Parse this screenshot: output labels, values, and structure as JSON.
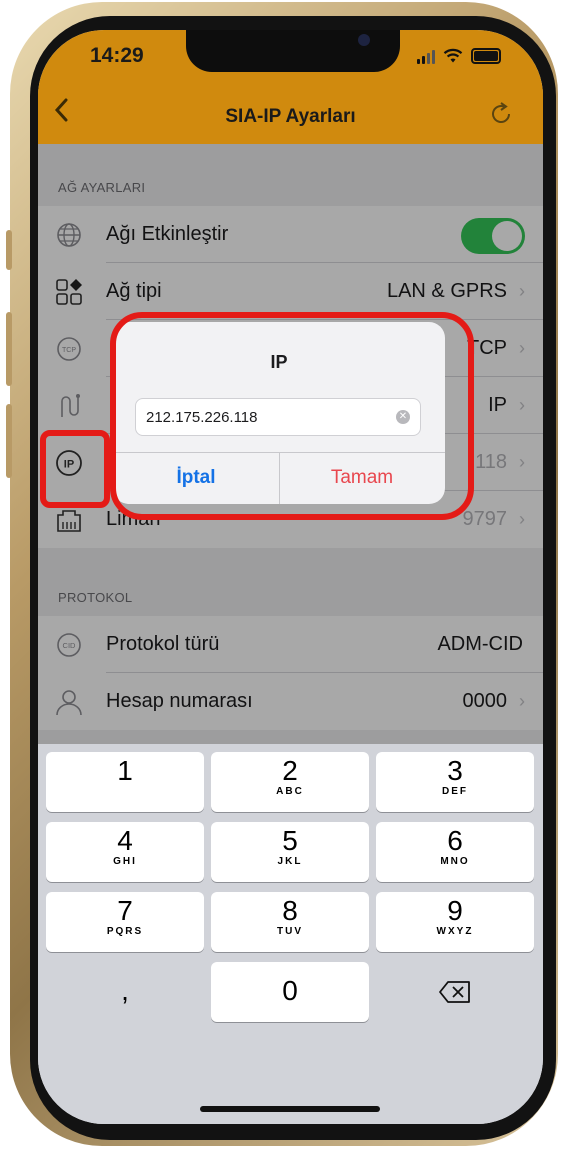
{
  "status_bar": {
    "time": "14:29"
  },
  "nav": {
    "back_icon": "chevron-left-icon",
    "title": "SIA-IP Ayarları",
    "refresh_icon": "refresh-icon"
  },
  "sections": {
    "network": {
      "header": "AĞ AYARLARI",
      "rows": [
        {
          "icon": "globe-icon",
          "label": "Ağı Etkinleştir",
          "toggle_on": true
        },
        {
          "icon": "network-type-icon",
          "label": "Ağ tipi",
          "value": "LAN & GPRS"
        },
        {
          "icon": "tcp-icon",
          "label": "",
          "value": "TCP"
        },
        {
          "icon": "route-icon",
          "label": "",
          "value": "IP"
        },
        {
          "icon": "ip-icon",
          "label": "",
          "value": "118"
        },
        {
          "icon": "port-icon",
          "label": "Liman",
          "value": "9797"
        }
      ]
    },
    "protocol": {
      "header": "PROTOKOL",
      "rows": [
        {
          "icon": "cid-icon",
          "label": "Protokol türü",
          "value": "ADM-CID"
        },
        {
          "icon": "user-icon",
          "label": "Hesap numarası",
          "value": "0000"
        }
      ]
    }
  },
  "dialog": {
    "title": "IP",
    "input_value": "212.175.226.118",
    "cancel_label": "İptal",
    "ok_label": "Tamam"
  },
  "keyboard": {
    "keys": [
      {
        "num": "1",
        "letters": ""
      },
      {
        "num": "2",
        "letters": "ABC"
      },
      {
        "num": "3",
        "letters": "DEF"
      },
      {
        "num": "4",
        "letters": "GHI"
      },
      {
        "num": "5",
        "letters": "JKL"
      },
      {
        "num": "6",
        "letters": "MNO"
      },
      {
        "num": "7",
        "letters": "PQRS"
      },
      {
        "num": "8",
        "letters": "TUV"
      },
      {
        "num": "9",
        "letters": "WXYZ"
      },
      {
        "num": ",",
        "letters": ""
      },
      {
        "num": "0",
        "letters": ""
      },
      {
        "num": "⌫",
        "letters": ""
      }
    ]
  },
  "colors": {
    "accent": "#d08a0e",
    "toggle": "#34c759",
    "highlight": "#e41b17"
  }
}
